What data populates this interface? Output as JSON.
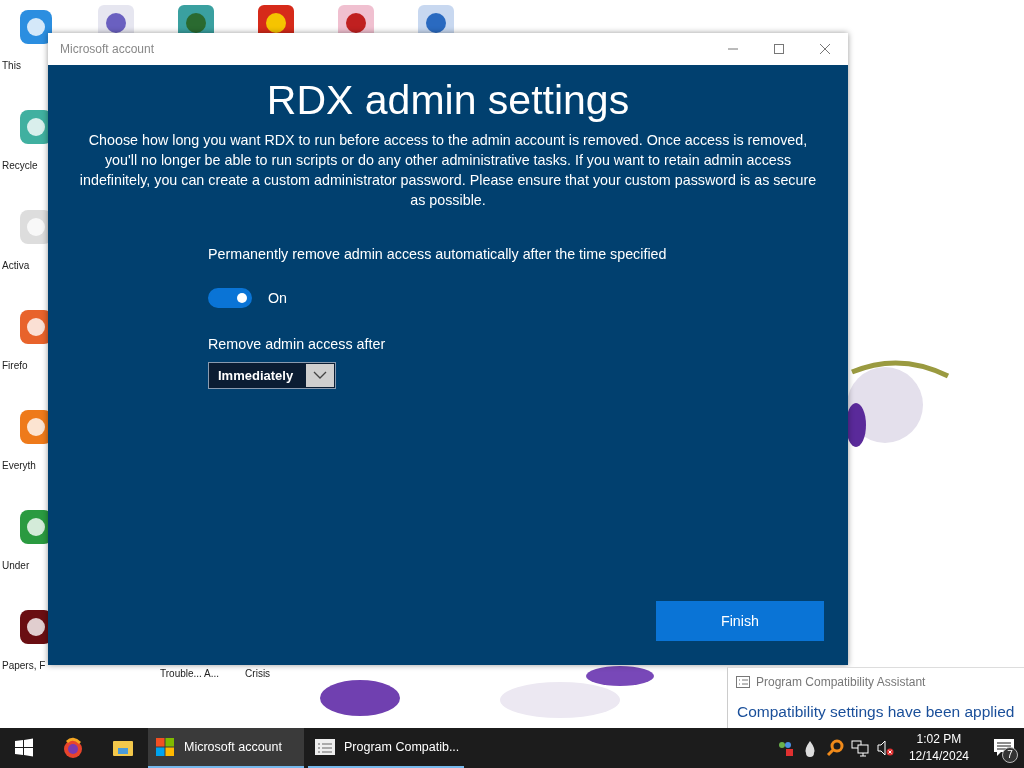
{
  "desktop": {
    "icons": [
      {
        "label": "This"
      },
      {
        "label": "Recycle"
      },
      {
        "label": "Activa"
      },
      {
        "label": "Firefo"
      },
      {
        "label": "Everyth"
      },
      {
        "label": "Under"
      },
      {
        "label": "Papers, F"
      }
    ],
    "bottom_labels": [
      "Trouble... A...",
      "Crisis"
    ]
  },
  "window": {
    "title": "Microsoft account",
    "heading": "RDX admin settings",
    "description": "Choose how long you want RDX to run before access to the admin account is removed. Once access is removed, you'll no longer be able to run scripts or do any other administrative tasks. If you want to retain admin access indefinitely, you can create a custom administrator password. Please ensure that your custom password is as secure as possible.",
    "toggle_label": "Permanently remove admin access automatically after the time specified",
    "toggle": {
      "on": true,
      "label": "On"
    },
    "dropdown_label": "Remove admin access after",
    "dropdown": {
      "value": "Immediately"
    },
    "button": "Finish"
  },
  "notification": {
    "app": "Program Compatibility Assistant",
    "message": "Compatibility settings have been applied"
  },
  "taskbar": {
    "tasks": [
      {
        "label": "Microsoft account",
        "selected": true
      },
      {
        "label": "Program Compatib...",
        "selected": false
      }
    ],
    "time": "1:02 PM",
    "date": "12/14/2024",
    "notification_count": "7"
  }
}
